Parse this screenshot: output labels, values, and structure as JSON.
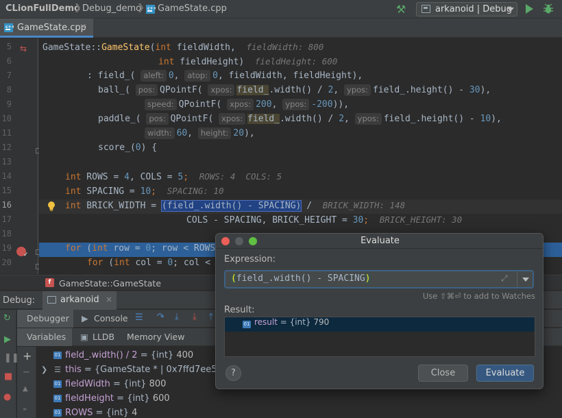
{
  "navbar": {
    "breadcrumbs": [
      "CLionFullDemo",
      "Debug_demo",
      "GameState.cpp"
    ],
    "run_config": "arkanoid | Debug"
  },
  "tab": {
    "label": "GameState.cpp",
    "close": "×"
  },
  "editor": {
    "line_numbers": [
      "5",
      "6",
      "7",
      "8",
      "9",
      "10",
      "11",
      "12",
      "13",
      "14",
      "15",
      "16",
      "17",
      "18",
      "19",
      "20"
    ],
    "current_line": "16",
    "execution_line": "19",
    "lines": {
      "l5": {
        "cls": "GameState",
        "sep": "::",
        "fn": "GameState",
        "open": "(",
        "kw": "int",
        "arg": " fieldWidth,",
        "inline": "fieldWidth: 800"
      },
      "l6": {
        "kw": "int",
        "arg": " fieldHeight)",
        "inline": "fieldHeight: 600"
      },
      "l7": {
        "a": ": field_(",
        "h1": "aleft:",
        "n1": "0",
        "c1": ",",
        "h2": "atop:",
        "n2": "0",
        "rest": ", fieldWidth, fieldHeight),"
      },
      "l8": {
        "a": "ball_(",
        "h1": "pos:",
        "b": "QPointF(",
        "h2": "xpos:",
        "u": "field_",
        "c": ".width() / ",
        "n1": "2",
        "d": ",",
        "h3": "ypos:",
        "e": "field_.height() - ",
        "n2": "30",
        "f": "),"
      },
      "l9": {
        "h1": "speed:",
        "b": "QPointF(",
        "h2": "xpos:",
        "n1": "200",
        "c": ",",
        "h3": "ypos:",
        "n2": "-200",
        "f": ")),"
      },
      "l10": {
        "a": "paddle_(",
        "h1": "pos:",
        "b": "QPointF(",
        "h2": "xpos:",
        "u": "field_",
        "c": ".width() / ",
        "n1": "2",
        "d": ",",
        "h3": "ypos:",
        "e": "field_.height() - ",
        "n2": "10",
        "f": "),"
      },
      "l11": {
        "h1": "width:",
        "n1": "60",
        "c": ",",
        "h2": "height:",
        "n2": "20",
        "f": "),"
      },
      "l12": {
        "a": "score_(",
        "n1": "0",
        "f": ") {"
      },
      "l14": {
        "kw": "int",
        "a": " ROWS = ",
        "n1": "4",
        "b": ", COLS = ",
        "n2": "5",
        "c": ";",
        "inline": "ROWS: 4  COLS: 5"
      },
      "l15": {
        "kw": "int",
        "a": " SPACING = ",
        "n1": "10",
        "c": ";",
        "inline": "SPACING: 10"
      },
      "l16": {
        "kw": "int",
        "a": " BRICK_WIDTH = ",
        "sel": "(field_.width() - SPACING)",
        "b": " /",
        "inline": "BRICK_WIDTH: 148"
      },
      "l17": {
        "a": "COLS - SPACING, BRICK_HEIGHT = ",
        "n1": "30",
        "c": ";",
        "inline": "BRICK_HEIGHT: 30"
      },
      "l19": {
        "kw": "for",
        "a": " (",
        "kw2": "int",
        "b": " row = ",
        "n1": "0",
        "c": "; row < ROWS"
      },
      "l20": {
        "kw": "for",
        "a": " (",
        "kw2": "int",
        "b": " col = ",
        "n1": "0",
        "c": "; col < "
      }
    }
  },
  "structure_breadcrumb": {
    "icon": "f",
    "label": "GameState::GameState"
  },
  "debug": {
    "label": "Debug:",
    "session_tab": "arkanoid",
    "session_close": "×",
    "toolbar_tabs": [
      "Debugger",
      "Console"
    ],
    "sub_tabs": [
      "Variables",
      "LLDB",
      "Memory View"
    ],
    "variables": [
      {
        "name": "field_.width() / 2",
        "type": " = {int} ",
        "value": "400"
      },
      {
        "name": "this",
        "type": " = {GameState * | 0x7ffd7ee5a",
        "value": ""
      },
      {
        "name": "fieldWidth",
        "type": " = {int} ",
        "value": "800"
      },
      {
        "name": "fieldHeight",
        "type": " = {int} ",
        "value": "600"
      },
      {
        "name": "ROWS",
        "type": " = {int} ",
        "value": "4"
      }
    ],
    "badge": "01"
  },
  "evaluate_dialog": {
    "title": "Evaluate",
    "expression_label": "Expression:",
    "expression_open": "(",
    "expression_body": "field_.width() - SPACING",
    "expression_close": ")",
    "watch_hint": "Use ⇧⌘⏎ to add to Watches",
    "result_label": "Result:",
    "result_name": "result",
    "result_type": " = {int} ",
    "result_value": "790",
    "help": "?",
    "close_label": "Close",
    "evaluate_label": "Evaluate"
  },
  "colors": {
    "keyword": "#cc7832",
    "function": "#ffc66d",
    "number": "#6897bb",
    "selection": "#214283",
    "execution_line": "#2d6099",
    "run_green": "#59a869",
    "breakpoint_red": "#c75450"
  }
}
